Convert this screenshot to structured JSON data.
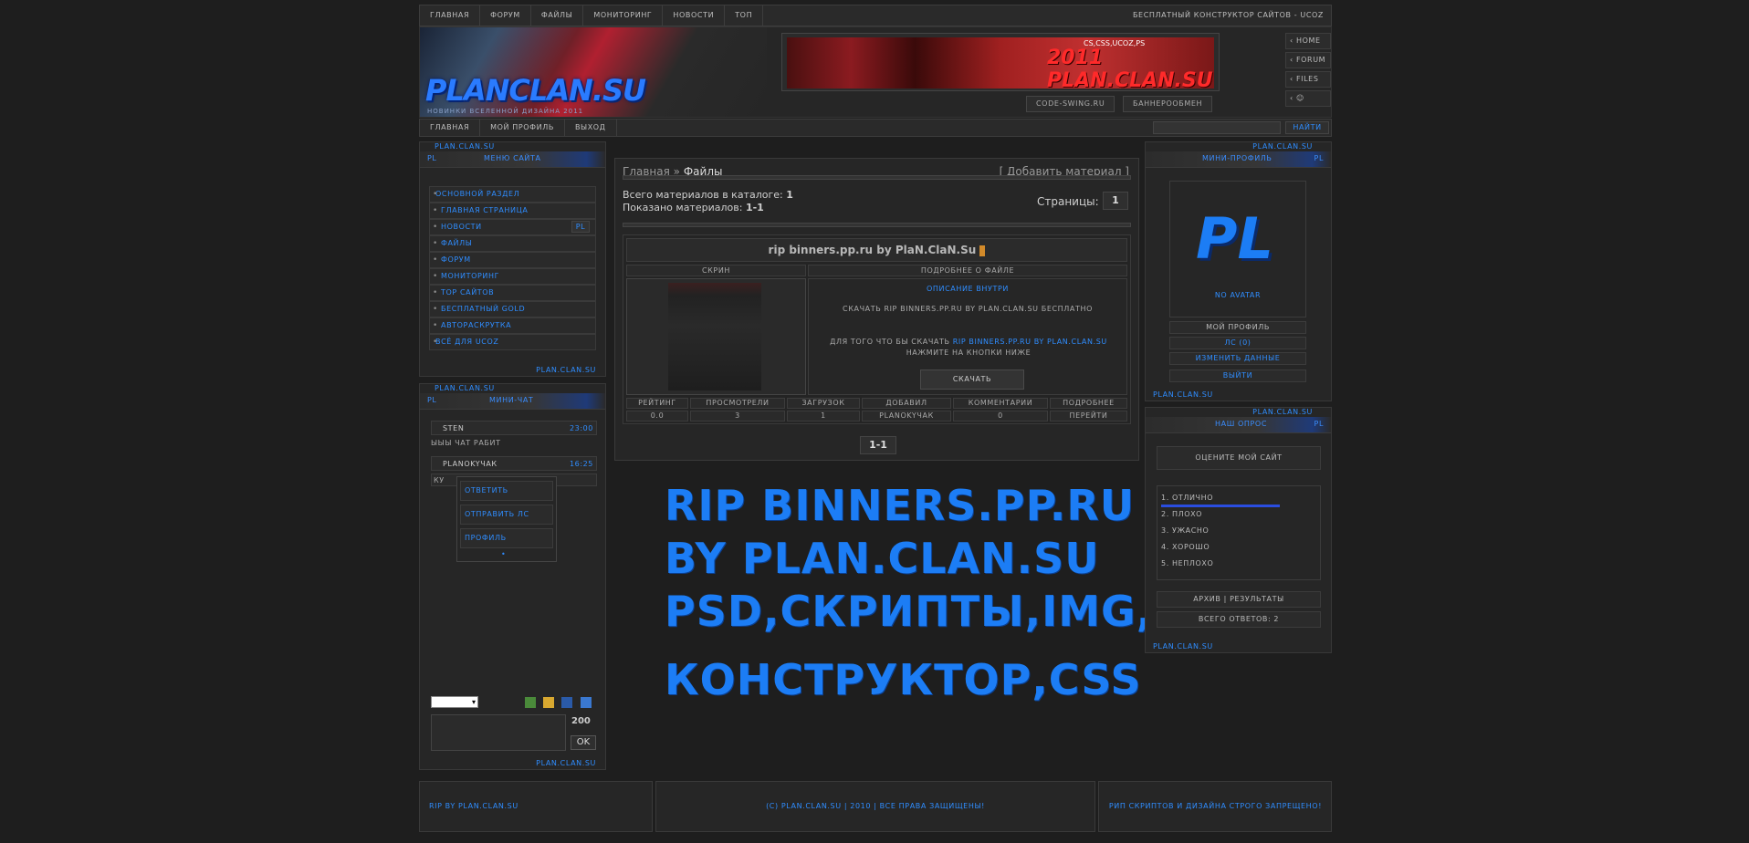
{
  "topnav": [
    "Главная",
    "Форум",
    "Файлы",
    "Мониторинг",
    "Новости",
    "Топ"
  ],
  "topright": "Бесплатный конструктор сайтов - uCoz",
  "logo": {
    "text": "PLANCLAN.SU",
    "subtitle": "Новинки вселенной дизайна 2011"
  },
  "banner": {
    "text": "2011 PLAN.CLAN.SU",
    "tag": "CS,CSS,UCOZ,PS",
    "btn1": "code-swing.ru",
    "btn2": "баннерообмен"
  },
  "sidebuttons": [
    "HOME",
    "FORUM",
    "FILES",
    "☺"
  ],
  "subnav": [
    "Главная",
    "Мой профиль",
    "Выход"
  ],
  "search_btn": "Найти",
  "left_menu": {
    "title": "Меню сайта",
    "brand": "plan.clan.su",
    "tag": "PL",
    "head": "Основной раздел",
    "items": [
      "Главная страница",
      "Новости",
      "Файлы",
      "Форум",
      "Мониторинг",
      "TOP сайтов",
      "Бесплатный gold",
      "Автораскрутка"
    ],
    "news_tag": "PL",
    "foot": "Всё для uCoz"
  },
  "chat": {
    "title": "Мини-чат",
    "msg1_user": "Sten",
    "msg1_time": "23:00",
    "msg1_text": "ыыы чат рабит",
    "msg2_user": "PlanokyЧак",
    "msg2_time": "16:25",
    "msg2_text": "ку",
    "menu": [
      "Ответить",
      "Отправить ЛС",
      "Профиль"
    ],
    "counter": "200",
    "ok": "OK"
  },
  "content": {
    "crumb_home": "Главная",
    "crumb_sep": "»",
    "crumb_cur": "Файлы",
    "add": "[ Добавить материал ]",
    "total_label": "Всего материалов в каталоге:",
    "total": "1",
    "shown_label": "Показано материалов:",
    "shown": "1-1",
    "pages_label": "Страницы:",
    "page": "1",
    "entry_title": "rip binners.pp.ru by PlaN.ClaN.Su",
    "col1": "Скрин",
    "col2": "Подробнее о файле",
    "desc_head": "Описание внутри",
    "desc_line": "Скачать rip binners.pp.ru by plan.clan.su бесплатно",
    "desc2_a": "Для того что бы скачать",
    "desc2_link": "rip binners.pp.ru by plan.clan.su",
    "desc2_b": "нажмите на кнопки ниже",
    "download": "Скачать",
    "stats_heads": [
      "Рейтинг",
      "Просмотрели",
      "Загрузок",
      "Добавил",
      "Комментарии",
      "Подробнее"
    ],
    "stats_vals": [
      "0.0",
      "3",
      "1",
      "PlanokyЧак",
      "0",
      "Перейти"
    ],
    "pager_bottom": "1-1"
  },
  "promo": [
    "RIP BINNERS.PP.RU",
    "BY PLAN.CLAN.SU",
    "PSD,СКРИПТЫ,IMG,",
    "КОНСТРУКТОР,CSS"
  ],
  "right_profile": {
    "title": "Мини-профиль",
    "brand": "plan.clan.su",
    "tag": "PL",
    "avatar_text": "PL",
    "no_avatar": "No avatar",
    "links": [
      "Мой профиль",
      "ЛС (0)",
      "Изменить данные",
      "Выйти"
    ]
  },
  "poll": {
    "title": "Наш опрос",
    "brand": "plan.clan.su",
    "question": "Оцените мой сайт",
    "options": [
      "1. Отлично",
      "2. Плохо",
      "3. Ужасно",
      "4. Хорошо",
      "5. Неплохо"
    ],
    "archive": "Архив | Результаты",
    "total": "Всего ответов: 2"
  },
  "footer": {
    "left": "Rip by plan.clan.su",
    "center": "(c) plan.clan.su | 2010 | Все права защищены!",
    "right": "Рип скриптов и дизайна строго запрещено!"
  },
  "colors": {
    "accent": "#2f8dff",
    "bg": "#1e1e1e",
    "panel": "#262626"
  }
}
